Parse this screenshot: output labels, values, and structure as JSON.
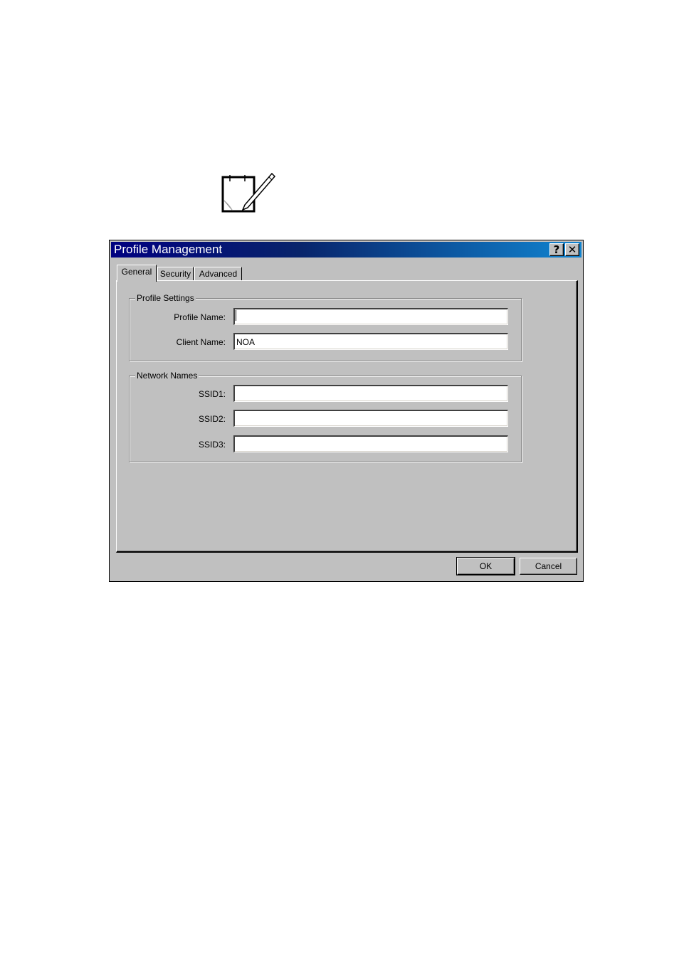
{
  "note": {
    "icon": "notepad-pencil-icon"
  },
  "window": {
    "title": "Profile Management",
    "help_label": "?",
    "close_label": "✕"
  },
  "tabs": [
    {
      "label": "General",
      "active": true
    },
    {
      "label": "Security",
      "active": false
    },
    {
      "label": "Advanced",
      "active": false
    }
  ],
  "profile_settings": {
    "legend": "Profile Settings",
    "profile_name_label": "Profile Name:",
    "profile_name_value": "",
    "client_name_label": "Client Name:",
    "client_name_value": "NOA"
  },
  "network_names": {
    "legend": "Network Names",
    "ssid1_label": "SSID1:",
    "ssid1_value": "",
    "ssid2_label": "SSID2:",
    "ssid2_value": "",
    "ssid3_label": "SSID3:",
    "ssid3_value": ""
  },
  "buttons": {
    "ok_label": "OK",
    "cancel_label": "Cancel"
  },
  "colors": {
    "titlebar_start": "#000080",
    "titlebar_end": "#1084d0",
    "face": "#c0c0c0"
  }
}
